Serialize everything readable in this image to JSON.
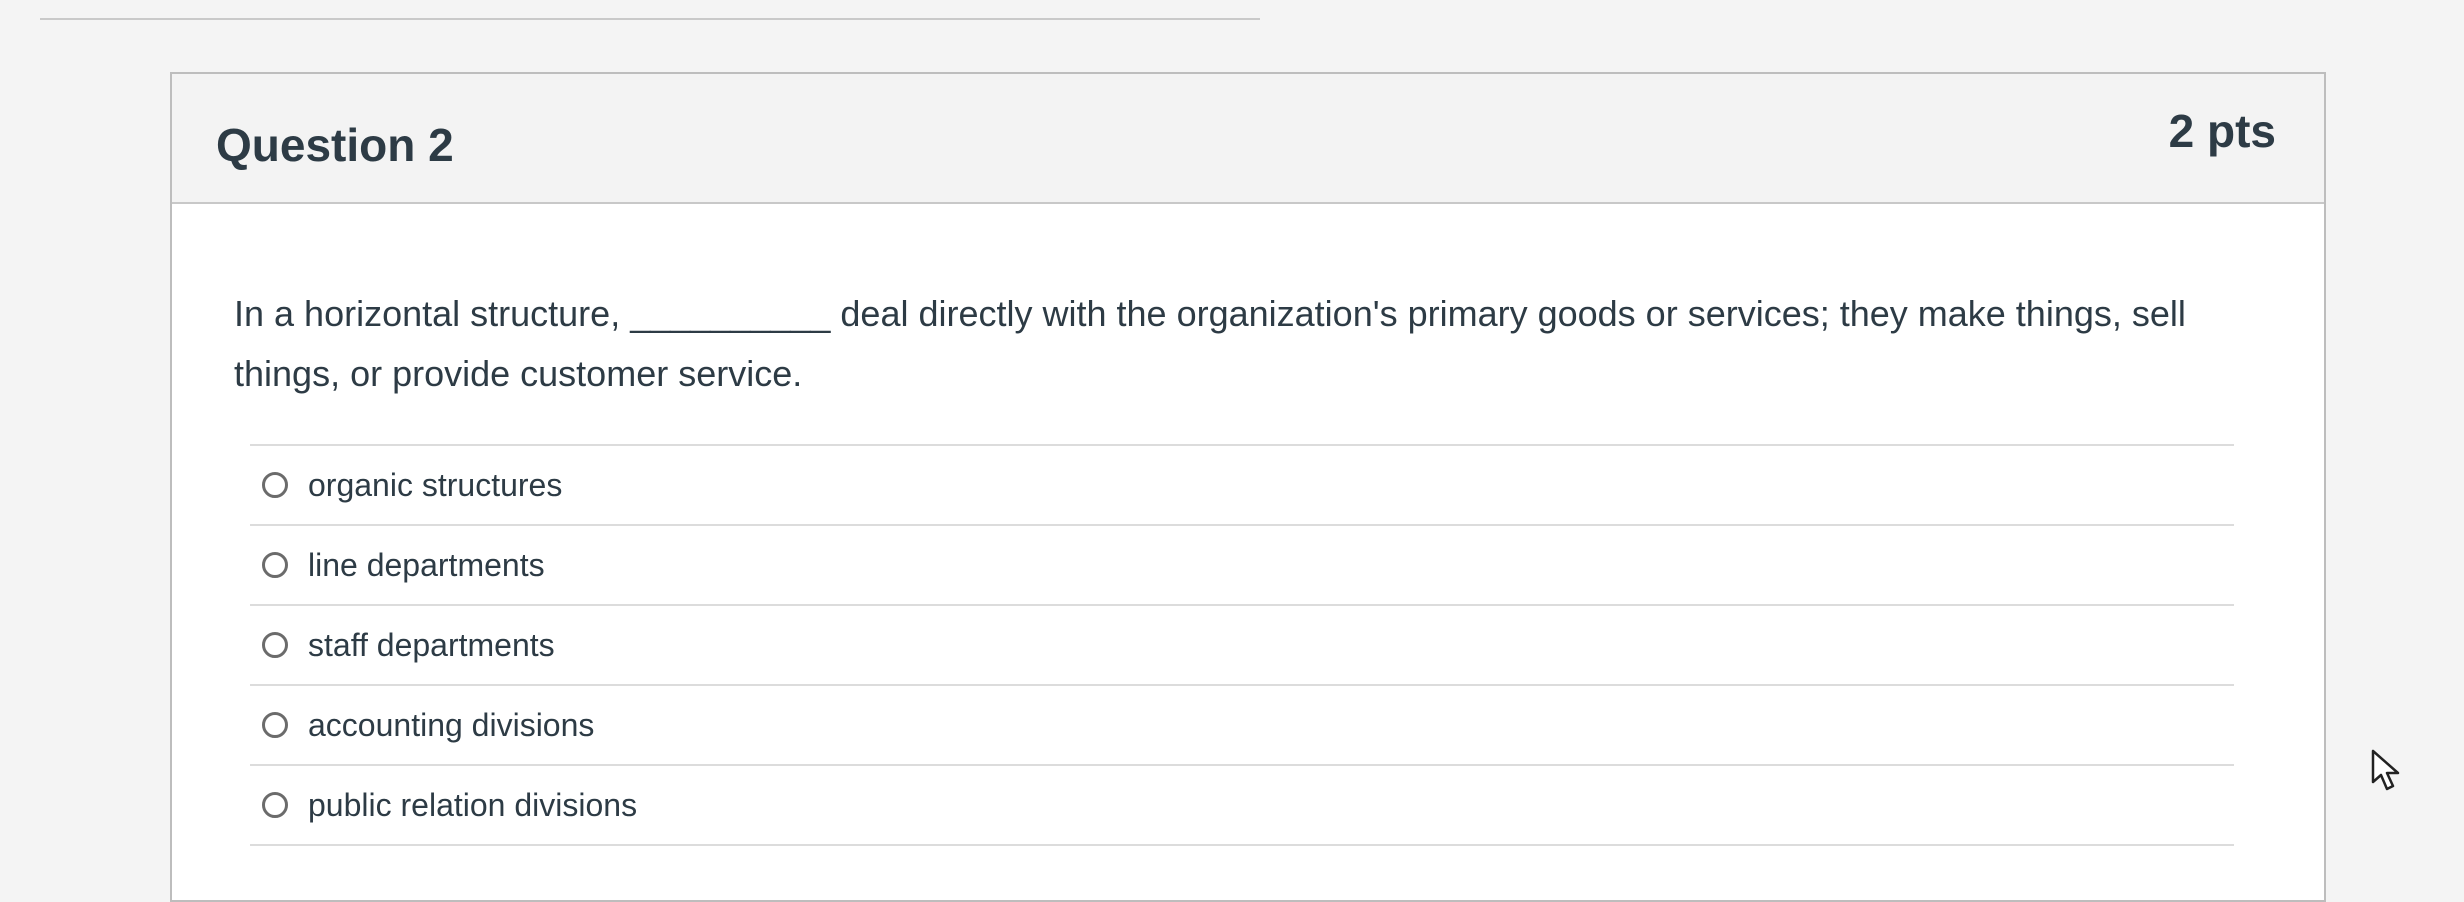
{
  "question": {
    "title": "Question 2",
    "points": "2 pts",
    "text": "In a horizontal structure, __________ deal directly with the organization's primary goods or services; they make things, sell things, or provide customer service.",
    "answers": [
      {
        "label": "organic structures",
        "selected": false
      },
      {
        "label": "line departments",
        "selected": false
      },
      {
        "label": "staff departments",
        "selected": false
      },
      {
        "label": "accounting divisions",
        "selected": false
      },
      {
        "label": "public relation divisions",
        "selected": false
      }
    ]
  },
  "icons": {
    "cursor": "mouse-pointer-icon",
    "radio": "radio-button-icon"
  }
}
